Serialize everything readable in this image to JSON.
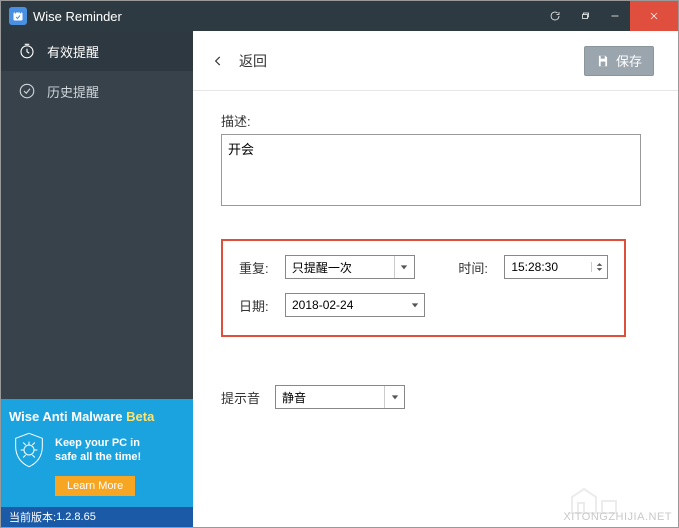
{
  "app": {
    "title": "Wise Reminder"
  },
  "window_controls": {
    "refresh": "refresh",
    "restore": "restore",
    "minimize": "minimize",
    "close": "close"
  },
  "sidebar": {
    "items": [
      {
        "label": "有效提醒",
        "icon": "clock"
      },
      {
        "label": "历史提醒",
        "icon": "check-circle"
      }
    ]
  },
  "promo": {
    "title_main": "Wise Anti Malware ",
    "title_beta": "Beta",
    "line1": "Keep your PC in",
    "line2": "safe all the time!",
    "cta": "Learn More"
  },
  "statusbar": {
    "version_label": "当前版本:",
    "version": "1.2.8.65"
  },
  "topbar": {
    "back": "返回",
    "save": "保存"
  },
  "form": {
    "desc_label": "描述:",
    "desc_value": "开会",
    "repeat_label": "重复:",
    "repeat_value": "只提醒一次",
    "time_label": "时间:",
    "time_value": "15:28:30",
    "date_label": "日期:",
    "date_value": "2018-02-24",
    "sound_label": "提示音",
    "sound_value": "静音"
  },
  "watermark": "XITONGZHIJIA.NET"
}
